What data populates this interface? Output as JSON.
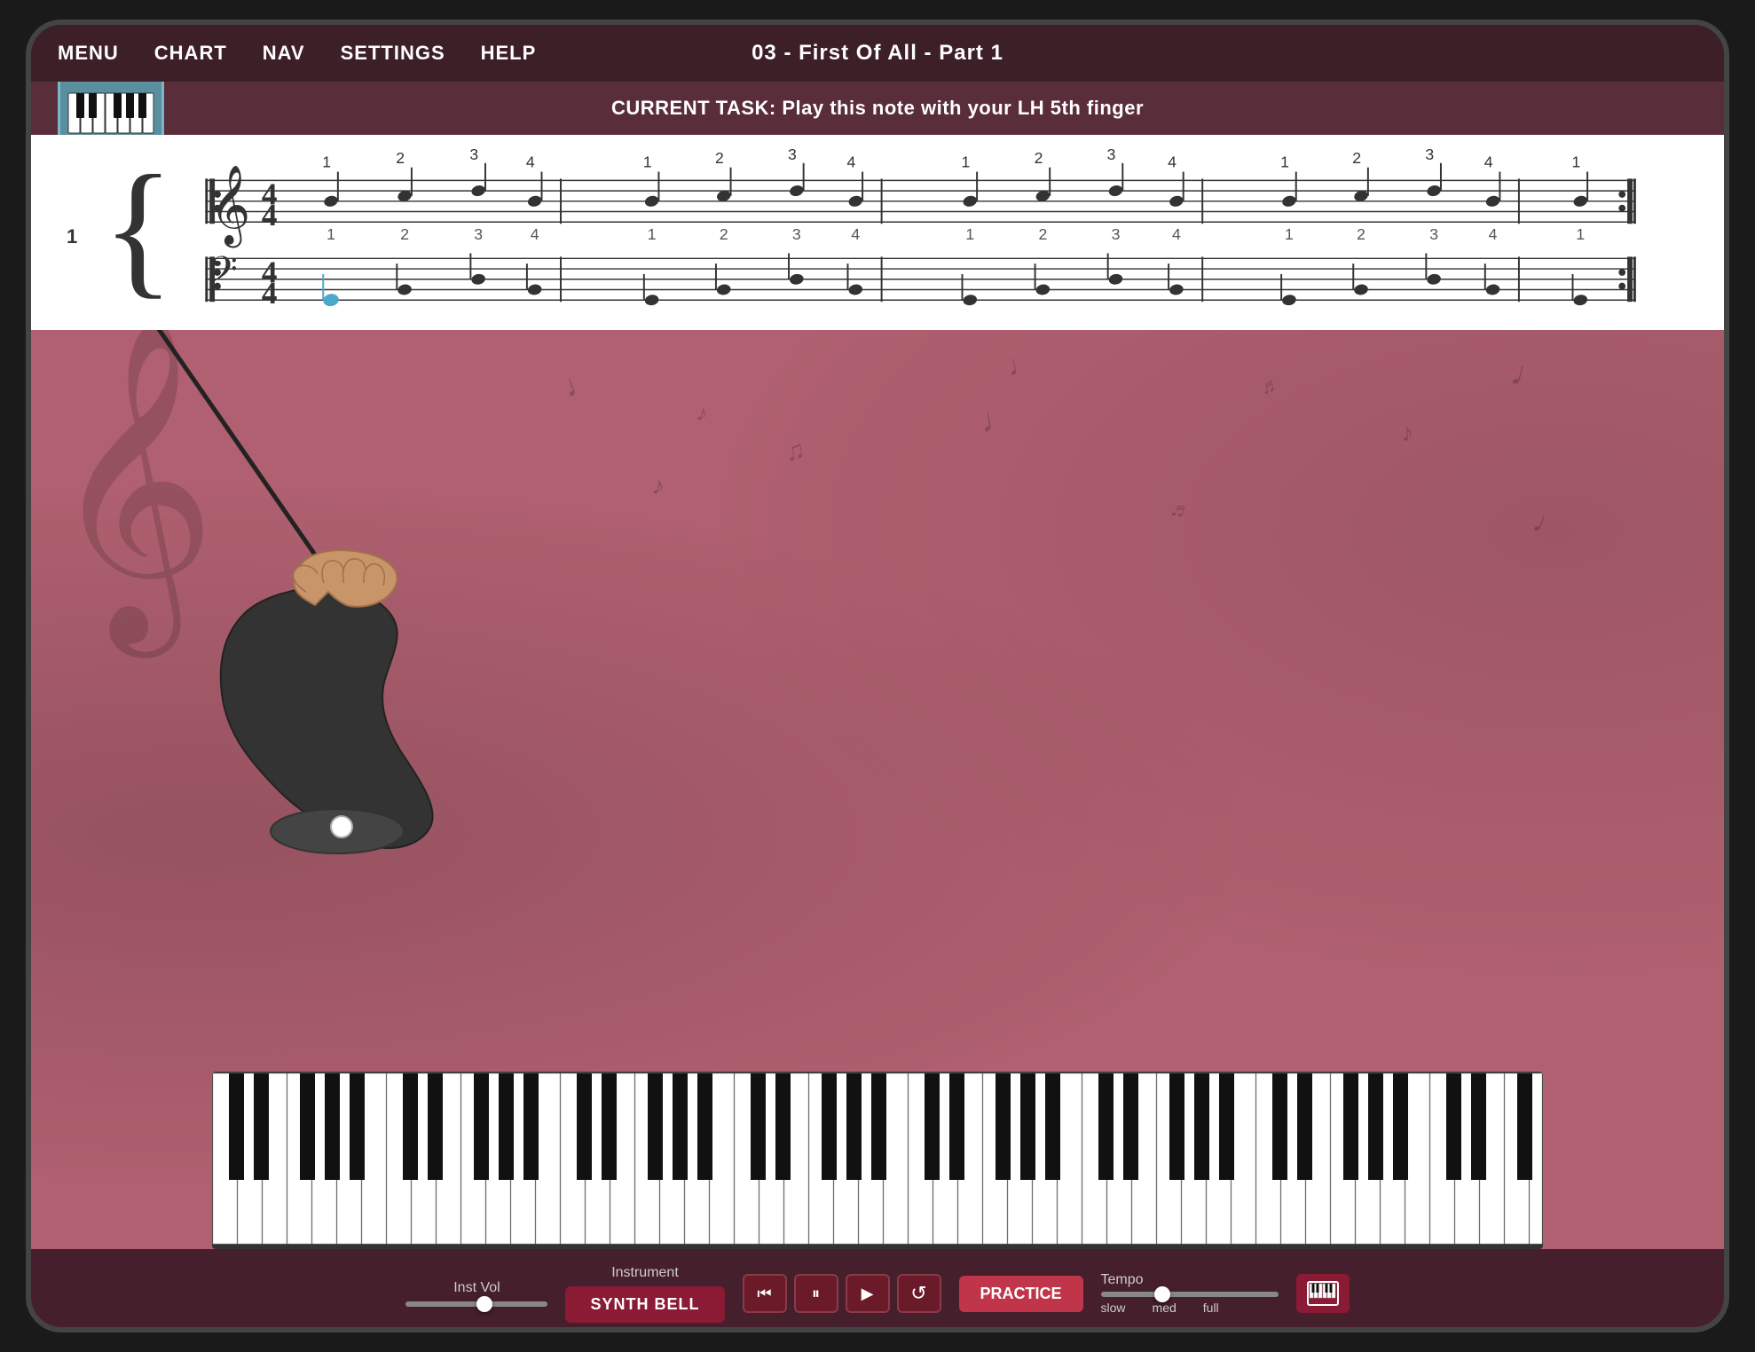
{
  "nav": {
    "items": [
      "MENU",
      "CHART",
      "NAV",
      "SETTINGS",
      "HELP"
    ],
    "title": "03 - First Of All - Part 1"
  },
  "task": {
    "text": "CURRENT TASK: Play this note with your LH 5th finger"
  },
  "sheet": {
    "measure_number": "1",
    "time_signature_top": "4",
    "time_signature_bottom": "4",
    "beat_numbers": [
      "1",
      "2",
      "3",
      "4",
      "1",
      "2",
      "3",
      "4",
      "1",
      "2",
      "3",
      "4",
      "1",
      "2",
      "3",
      "4",
      "1"
    ]
  },
  "controls": {
    "inst_vol_label": "Inst Vol",
    "instrument_label": "Instrument",
    "instrument_value": "SYNTH BELL",
    "tempo_label": "Tempo",
    "tempo_slow": "slow",
    "tempo_med": "med",
    "tempo_full": "full",
    "practice_label": "PRACTICE",
    "transport": {
      "rewind": "⏮",
      "pause": "⏸",
      "play": "▶",
      "loop": "↺"
    }
  },
  "colors": {
    "nav_bg": "#3d1f28",
    "task_bg": "#5a2d3a",
    "main_bg": "#b06070",
    "piano_icon_bg": "#5a8fa0",
    "instrument_btn": "#8b1a35",
    "practice_btn": "#c0354a"
  }
}
